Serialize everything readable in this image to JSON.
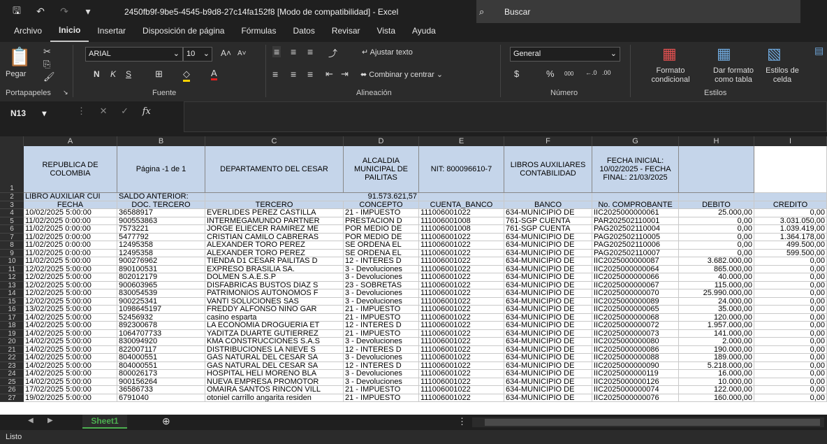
{
  "titlebar": {
    "title": "2450fb9f-9be5-4545-b9d8-27c14fa152f8  [Modo de compatibilidad]  -  Excel",
    "search": "Buscar"
  },
  "menu": [
    "Archivo",
    "Inicio",
    "Insertar",
    "Disposición de página",
    "Fórmulas",
    "Datos",
    "Revisar",
    "Vista",
    "Ayuda"
  ],
  "ribbon": {
    "paste": "Pegar",
    "font_name": "ARIAL",
    "font_size": "10",
    "bold": "N",
    "italic": "K",
    "underline": "S",
    "wrap": "Ajustar texto",
    "merge": "Combinar y centrar",
    "number_format": "General",
    "currency": "$",
    "percent": "%",
    "thousands": "000",
    "cond_format": "Formato condicional",
    "format_table": "Dar formato como tabla",
    "cell_styles": "Estilos de celda",
    "groups": {
      "clipboard": "Portapapeles",
      "font": "Fuente",
      "alignment": "Alineación",
      "number": "Número",
      "styles": "Estilos"
    }
  },
  "namebox": "N13",
  "fx": "fx",
  "columns": [
    "A",
    "B",
    "C",
    "D",
    "E",
    "F",
    "G",
    "H",
    "I"
  ],
  "header_row": {
    "a": "REPUBLICA DE COLOMBIA",
    "b": "Página -1 de 1",
    "c": "DEPARTAMENTO DEL CESAR",
    "d": "ALCALDIA MUNICIPAL DE PAILITAS",
    "e": "NIT: 800096610-7",
    "f": "LIBROS AUXILIARES CONTABILIDAD",
    "g": "FECHA INICIAL: 10/02/2025 - FECHA FINAL: 21/03/2025"
  },
  "row2": {
    "a": "LIBRO AUXILIAR CUI",
    "b": "SALDO ANTERIOR:",
    "c": "91.573.621,57"
  },
  "row3": [
    "FECHA",
    "DOC. TERCERO",
    "TERCERO",
    "CONCEPTO",
    "CUENTA_BANCO",
    "BANCO",
    "No. COMPROBANTE",
    "DEBITO",
    "CREDITO"
  ],
  "rows": [
    [
      "10/02/2025  5:00:00",
      "36588917",
      "EVERLIDES PEREZ CASTILLA",
      "21 - IMPUESTO",
      "111006001022",
      "634-MUNICIPIO DE",
      "IIC2025000000061",
      "25.000,00",
      "0,00"
    ],
    [
      "11/02/2025  0:00:00",
      "900553863",
      "INTERMEGAMUNDO PARTNER",
      "PRESTACION D",
      "111006001008",
      "761-SGP CUENTA",
      "PAR202502110001",
      "0,00",
      "3.031.050,00"
    ],
    [
      "11/02/2025  0:00:00",
      "7573221",
      "JORGE ELIECER  RAMIREZ ME",
      "POR MEDIO DE",
      "111006001008",
      "761-SGP CUENTA",
      "PAG202502110004",
      "0,00",
      "1.039.419,00"
    ],
    [
      "11/02/2025  0:00:00",
      "5477792",
      "CRISTIAN CAMILO  CABRERAS",
      "POR MEDIO DE",
      "111006001022",
      "634-MUNICIPIO DE",
      "PAG202502110005",
      "0,00",
      "1.364.178,00"
    ],
    [
      "11/02/2025  0:00:00",
      "12495358",
      "ALEXANDER  TORO PEREZ",
      "SE ORDENA EL",
      "111006001022",
      "634-MUNICIPIO DE",
      "PAG202502110006",
      "0,00",
      "499.500,00"
    ],
    [
      "11/02/2025  0:00:00",
      "12495358",
      "ALEXANDER  TORO PEREZ",
      "SE ORDENA EL",
      "111006001022",
      "634-MUNICIPIO DE",
      "PAG202502110007",
      "0,00",
      "599.500,00"
    ],
    [
      "11/02/2025  5:00:00",
      "900276962",
      "TIENDA D1 CESAR PAILITAS D",
      "12 - INTERÉS D",
      "111006001022",
      "634-MUNICIPIO DE",
      "IIC2025000000087",
      "3.682.000,00",
      "0,00"
    ],
    [
      "12/02/2025  5:00:00",
      "890100531",
      "EXPRESO BRASILIA SA.",
      "3 - Devoluciones",
      "111006001022",
      "634-MUNICIPIO DE",
      "IIC2025000000064",
      "865.000,00",
      "0,00"
    ],
    [
      "12/02/2025  5:00:00",
      "802012179",
      "DOLMEN S.A.E.S.P",
      "3 - Devoluciones",
      "111006001022",
      "634-MUNICIPIO DE",
      "IIC2025000000066",
      "40.000,00",
      "0,00"
    ],
    [
      "12/02/2025  5:00:00",
      "900603965",
      "DISFABRICAS BUSTOS DIAZ S",
      "23 - SOBRETAS",
      "111006001022",
      "634-MUNICIPIO DE",
      "IIC2025000000067",
      "115.000,00",
      "0,00"
    ],
    [
      "12/02/2025  5:00:00",
      "830054539",
      "PATRIMONIOS AUTONOMOS F",
      "3 - Devoluciones",
      "111006001022",
      "634-MUNICIPIO DE",
      "IIC2025000000070",
      "25.990.000,00",
      "0,00"
    ],
    [
      "12/02/2025  5:00:00",
      "900225341",
      "VANTI SOLUCIONES SAS",
      "3 - Devoluciones",
      "111006001022",
      "634-MUNICIPIO DE",
      "IIC2025000000089",
      "24.000,00",
      "0,00"
    ],
    [
      "13/02/2025  5:00:00",
      "1098645197",
      "FREDDY ALFONSO NIÑO GAR",
      "21 - IMPUESTO",
      "111006001022",
      "634-MUNICIPIO DE",
      "IIC2025000000065",
      "35.000,00",
      "0,00"
    ],
    [
      "14/02/2025  5:00:00",
      "52456932",
      "casino esparta",
      "21 - IMPUESTO",
      "111006001022",
      "634-MUNICIPIO DE",
      "IIC2025000000068",
      "120.000,00",
      "0,00"
    ],
    [
      "14/02/2025  5:00:00",
      "892300678",
      "LA ECONOMIA DROGUERIA ET",
      "12 - INTERÉS D",
      "111006001022",
      "634-MUNICIPIO DE",
      "IIC2025000000072",
      "1.957.000,00",
      "0,00"
    ],
    [
      "14/02/2025  5:00:00",
      "1064707733",
      "YADITZA DUARTE GUTIERREZ",
      "21 - IMPUESTO",
      "111006001022",
      "634-MUNICIPIO DE",
      "IIC2025000000073",
      "141.000,00",
      "0,00"
    ],
    [
      "14/02/2025  5:00:00",
      "830094920",
      "KMA CONSTRUCCIONES S.A.S",
      "3 - Devoluciones",
      "111006001022",
      "634-MUNICIPIO DE",
      "IIC2025000000080",
      "2.000,00",
      "0,00"
    ],
    [
      "14/02/2025  5:00:00",
      "822007117",
      "DISTRIBUCIONES LA NIEVE S",
      "12 - INTERÉS D",
      "111006001022",
      "634-MUNICIPIO DE",
      "IIC2025000000086",
      "190.000,00",
      "0,00"
    ],
    [
      "14/02/2025  5:00:00",
      "804000551",
      "GAS NATURAL DEL CESAR SA",
      "3 - Devoluciones",
      "111006001022",
      "634-MUNICIPIO DE",
      "IIC2025000000088",
      "189.000,00",
      "0,00"
    ],
    [
      "14/02/2025  5:00:00",
      "804000551",
      "GAS NATURAL DEL CESAR SA",
      "12 - INTERÉS D",
      "111006001022",
      "634-MUNICIPIO DE",
      "IIC2025000000090",
      "5.218.000,00",
      "0,00"
    ],
    [
      "14/02/2025  5:00:00",
      "800026173",
      "HOSPITAL HELI MORENO BLA",
      "3 - Devoluciones",
      "111006001022",
      "634-MUNICIPIO DE",
      "IIC2025000000119",
      "16.000,00",
      "0,00"
    ],
    [
      "14/02/2025  5:00:00",
      "900156264",
      "NUEVA EMPRESA PROMOTOR",
      "3 - Devoluciones",
      "111006001022",
      "634-MUNICIPIO DE",
      "IIC2025000000126",
      "10.000,00",
      "0,00"
    ],
    [
      "17/02/2025  5:00:00",
      "36586733",
      "OMAIRA SANTOS RINCON VILL",
      "21 - IMPUESTO",
      "111006001022",
      "634-MUNICIPIO DE",
      "IIC2025000000074",
      "122.000,00",
      "0,00"
    ],
    [
      "19/02/2025  5:00:00",
      "6791040",
      "otoniel carrillo angarita residen",
      "21 - IMPUESTO",
      "111006001022",
      "634-MUNICIPIO DE",
      "IIC2025000000076",
      "160.000,00",
      "0,00"
    ]
  ],
  "row_numbers": [
    "1",
    "2",
    "3",
    "4",
    "5",
    "6",
    "7",
    "8",
    "9",
    "10",
    "11",
    "12",
    "13",
    "14",
    "15",
    "16",
    "17",
    "18",
    "19",
    "20",
    "21",
    "22",
    "23",
    "24",
    "25",
    "26",
    "27"
  ],
  "sheet_tab": "Sheet1",
  "status": "Listo",
  "colors": {
    "header_fill": "#c5d5ea",
    "accent": "#4caf50"
  }
}
